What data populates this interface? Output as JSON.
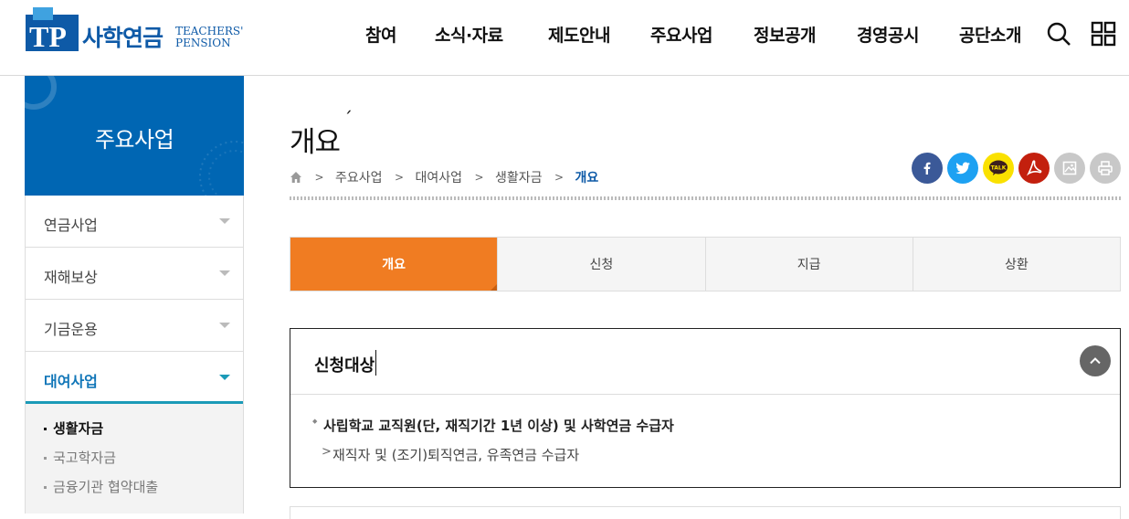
{
  "header": {
    "logo_mark": "TP",
    "logo_name": "사학연금",
    "logo_eng_1": "TEACHERS'",
    "logo_eng_2": "PENSION",
    "nav": [
      "참여",
      "소식·자료",
      "제도안내",
      "주요사업",
      "정보공개",
      "경영공시",
      "공단소개"
    ],
    "search_icon": "search-icon",
    "menu_icon": "grid-menu-icon"
  },
  "sidebar": {
    "title": "주요사업",
    "items": [
      {
        "label": "연금사업"
      },
      {
        "label": "재해보상"
      },
      {
        "label": "기금운용"
      },
      {
        "label": "대여사업"
      }
    ],
    "sub_items": [
      {
        "label": "생활자금"
      },
      {
        "label": "국고학자금"
      },
      {
        "label": "금융기관 협약대출"
      }
    ]
  },
  "page": {
    "title": "개요",
    "title_mark": "ˊ",
    "breadcrumb": [
      "주요사업",
      "대여사업",
      "생활자금",
      "개요"
    ]
  },
  "share": [
    "facebook-icon",
    "twitter-icon",
    "kakaotalk-icon",
    "pdf-icon",
    "image-icon",
    "print-icon"
  ],
  "kakao_label": "TALK",
  "tabs": [
    "개요",
    "신청",
    "지급",
    "상환"
  ],
  "section": {
    "title": "신청대상",
    "main": "사립학교 교직원(단, 재직기간 1년 이상) 및 사학연금 수급자",
    "sub": "재직자 및 (조기)퇴직연금, 유족연금 수급자"
  },
  "colors": {
    "brand_blue": "#0066b3",
    "accent_orange": "#f07c22",
    "teal": "#1a9ab7"
  }
}
